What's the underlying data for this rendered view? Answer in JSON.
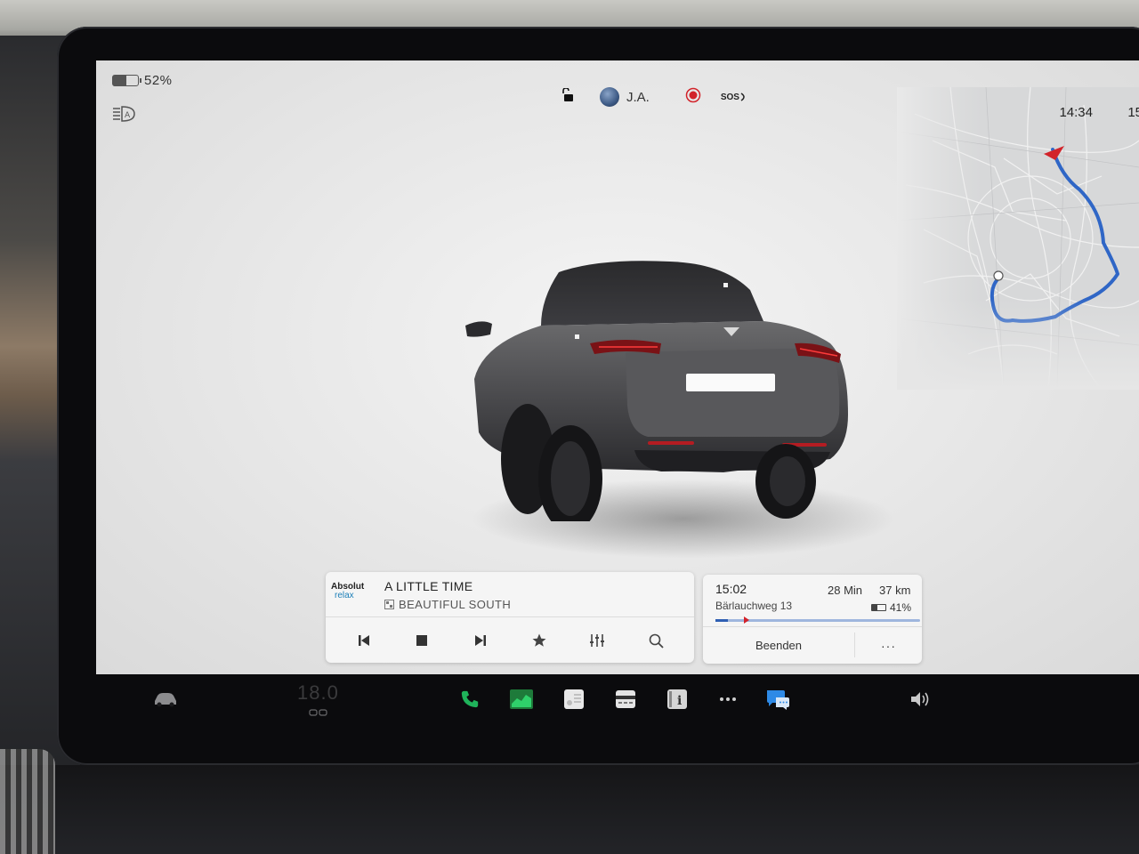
{
  "status_bar": {
    "battery_percent": "52%",
    "battery_level": 0.52,
    "user_name": "J.A.",
    "sos_label": "SOS"
  },
  "map": {
    "time": "14:34",
    "temp_partial": "15"
  },
  "media": {
    "station_logo_line1": "Absolut",
    "station_logo_line2": "relax",
    "title": "A LITTLE TIME",
    "artist": "BEAUTIFUL SOUTH",
    "controls": [
      "previous-track",
      "stop",
      "next-track",
      "favorite",
      "equalizer",
      "search"
    ]
  },
  "navigation": {
    "eta": "15:02",
    "duration": "28 Min",
    "distance": "37 km",
    "destination": "Bärlauchweg 13",
    "arrival_battery": "41%",
    "arrival_battery_level": 0.41,
    "progress": 0.06,
    "end_label": "Beenden",
    "more_label": "···"
  },
  "dock": {
    "climate_temp": "18.0",
    "items": [
      "car",
      "phone",
      "energy",
      "notes",
      "dashcam",
      "manual",
      "more",
      "messages",
      "volume"
    ]
  },
  "colors": {
    "route": "#2f66c6",
    "record": "#d2232a",
    "phone": "#1fb35a",
    "messages": "#2e8ae6"
  }
}
